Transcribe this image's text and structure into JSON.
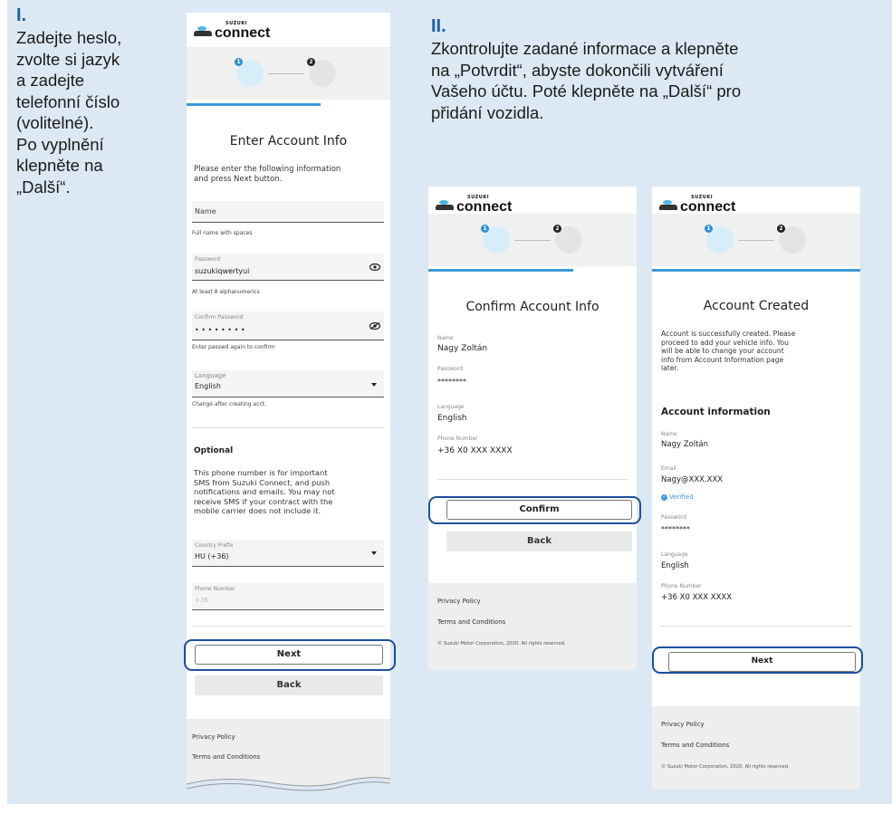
{
  "step1": {
    "num": "I.",
    "lines": [
      "Zadejte heslo,",
      "zvolte si jazyk",
      "a zadejte",
      "telefonní číslo",
      "(volitelné).",
      "Po vyplnění",
      "klepněte na",
      "„Další“."
    ]
  },
  "step2": {
    "num": "II.",
    "lines": [
      "Zkontrolujte zadané informace a klepněte",
      "na „Potvrdit“, abyste dokončili vytváření",
      "Vašeho účtu. Poté klepněte na „Další“ pro",
      "přidání vozidla."
    ]
  },
  "logo": {
    "brand": "SUZUKI",
    "product": "connect"
  },
  "steps": {
    "one": "1",
    "two": "2"
  },
  "colors": {
    "accent": "#3e9ad9",
    "highlight": "#1d4e9e",
    "panel": "#dce8f4"
  },
  "enter": {
    "title": "Enter Account Info",
    "intro": [
      "Please enter the following information",
      "and press Next button."
    ],
    "name_placeholder": "Name",
    "name_helper": "Full name with spaces",
    "password_label": "Password",
    "password_value": "suzukiqwertyui",
    "password_helper": "At least 8 alphanumerics",
    "confirm_label": "Confirm Password",
    "confirm_value": "• • • • • • • •",
    "confirm_helper": "Enter passwd again to confirm",
    "language_label": "Language",
    "language_value": "English",
    "language_helper": "Change after creating acct.",
    "optional_title": "Optional",
    "optional_text": [
      "This phone number is for important",
      "SMS from Suzuki Connect, and push",
      "notifications and emails. You may not",
      "receive SMS if your contract with the",
      "mobile carrier does not include it."
    ],
    "country_label": "Country Prefix",
    "country_value": "HU (+36)",
    "phone_label": "Phone Number",
    "phone_placeholder": "+36 -",
    "next": "Next",
    "back": "Back",
    "privacy": "Privacy Policy",
    "terms": "Terms and Conditions"
  },
  "confirm": {
    "title": "Confirm Account Info",
    "name_label": "Name",
    "name_value": "Nagy Zoltán",
    "password_label": "Password",
    "password_value": "********",
    "language_label": "Language",
    "language_value": "English",
    "phone_label": "Phone Number",
    "phone_value": "+36 X0 XXX XXXX",
    "confirm_button": "Confirm",
    "back": "Back",
    "privacy": "Privacy Policy",
    "terms": "Terms and Conditions",
    "copyright": "© Suzuki Motor Corporation, 2020. All rights reserved."
  },
  "created": {
    "title": "Account Created",
    "intro": [
      "Account is successfully created. Please",
      "proceed to add your vehicle info. You",
      "will be able to change your account",
      "info from Account Information page",
      "later."
    ],
    "section": "Account information",
    "name_label": "Name",
    "name_value": "Nagy Zoltán",
    "email_label": "Email",
    "email_value": "Nagy@XXX.XXX",
    "verified": "Verified",
    "password_label": "Password",
    "password_value": "********",
    "language_label": "Language",
    "language_value": "English",
    "phone_label": "Phone Number",
    "phone_value": "+36 X0 XXX XXXX",
    "next": "Next",
    "privacy": "Privacy Policy",
    "terms": "Terms and Conditions",
    "copyright": "© Suzuki Motor Corporation, 2020. All rights reserved."
  }
}
